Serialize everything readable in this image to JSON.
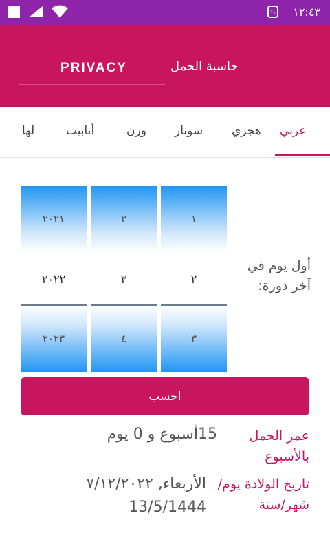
{
  "status_bar": {
    "time": "١٢:٤٣"
  },
  "app_bar": {
    "privacy_label": "PRIVACY",
    "title": "حاسبة الحمل"
  },
  "tabs": [
    {
      "label": "غربي",
      "active": true
    },
    {
      "label": "هجري",
      "active": false
    },
    {
      "label": "سونار",
      "active": false
    },
    {
      "label": "وزن",
      "active": false
    },
    {
      "label": "أنابيب",
      "active": false
    },
    {
      "label": "لها",
      "active": false
    }
  ],
  "date_picker": {
    "label": "أول يوم في آخر دورة:",
    "day": {
      "prev": "١",
      "selected": "٢",
      "next": "٣"
    },
    "month": {
      "prev": "٢",
      "selected": "٣",
      "next": "٤"
    },
    "year": {
      "prev": "٢٠٢١",
      "selected": "٢٠٢٢",
      "next": "٢٠٢٣"
    }
  },
  "calculate_button": "احسب",
  "results": {
    "age_label": "عمر الحمل بالأسبوع",
    "age_value": "15أسبوع و 0 يوم",
    "birth_label": "تاريخ الولادة يوم/شهر/سنة",
    "birth_greg": "الأربعاء, ٧/١٢/٢٠٢٢",
    "birth_hijri": "13/5/1444"
  },
  "colors": {
    "status_bar": "#8e24aa",
    "primary": "#c8155e",
    "picker_blue": "#2196f3"
  }
}
